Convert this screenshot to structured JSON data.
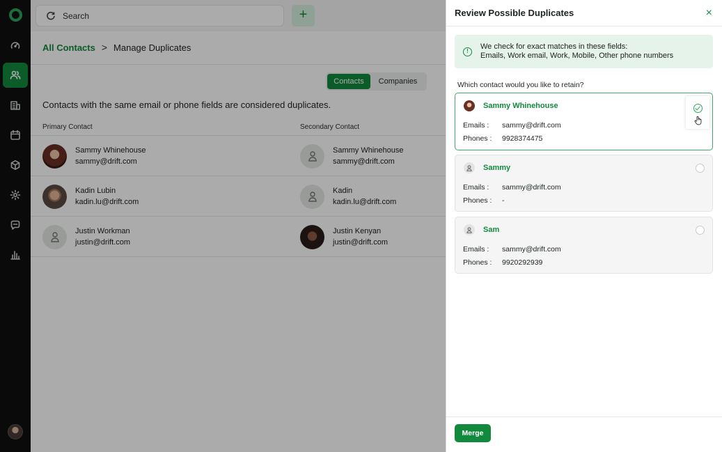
{
  "app": {
    "search_placeholder": "Search",
    "add_label": "+"
  },
  "sidebar": {
    "items": [
      {
        "name": "dashboard",
        "icon": "speedometer-icon",
        "active": false
      },
      {
        "name": "contacts",
        "icon": "users-icon",
        "active": true
      },
      {
        "name": "companies",
        "icon": "building-icon",
        "active": false
      },
      {
        "name": "calendar",
        "icon": "calendar-icon",
        "active": false
      },
      {
        "name": "products",
        "icon": "box-icon",
        "active": false
      },
      {
        "name": "settings",
        "icon": "gear-icon",
        "active": false
      },
      {
        "name": "chat",
        "icon": "chat-icon",
        "active": false
      },
      {
        "name": "reports",
        "icon": "bar-chart-icon",
        "active": false
      }
    ]
  },
  "breadcrumb": {
    "parent": "All Contacts",
    "separator": ">",
    "current": "Manage Duplicates"
  },
  "toggle": {
    "contacts": "Contacts",
    "companies": "Companies"
  },
  "main": {
    "description": "Contacts with the same email or phone fields are considered duplicates.",
    "col_primary": "Primary Contact",
    "col_secondary": "Secondary Contact",
    "rows": [
      {
        "primary": {
          "name": "Sammy Whinehouse",
          "email": "sammy@drift.com",
          "avatar": "photo-f"
        },
        "secondary": {
          "name": "Sammy Whinehouse",
          "email": "sammy@drift.com",
          "avatar": "ph"
        }
      },
      {
        "primary": {
          "name": "Kadin Lubin",
          "email": "kadin.lu@drift.com",
          "avatar": "photo-m"
        },
        "secondary": {
          "name": "Kadin",
          "email": "kadin.lu@drift.com",
          "avatar": "ph"
        }
      },
      {
        "primary": {
          "name": "Justin Workman",
          "email": "justin@drift.com",
          "avatar": "ph"
        },
        "secondary": {
          "name": "Justin Kenyan",
          "email": "justin@drift.com",
          "avatar": "photo-d"
        }
      }
    ]
  },
  "drawer": {
    "title": "Review Possible Duplicates",
    "close": "×",
    "info_line1": "We check for exact matches in these fields:",
    "info_line2": "Emails, Work email, Work, Mobile, Other phone numbers",
    "question": "Which contact would you like to retain?",
    "emails_label": "Emails :",
    "phones_label": "Phones :",
    "cards": [
      {
        "name": "Sammy Whinehouse",
        "email": "sammy@drift.com",
        "phone": "9928374475",
        "selected": true
      },
      {
        "name": "Sammy",
        "email": "sammy@drift.com",
        "phone": "-",
        "selected": false
      },
      {
        "name": "Sam",
        "email": "sammy@drift.com",
        "phone": "9920292939",
        "selected": false
      }
    ],
    "merge_label": "Merge"
  },
  "colors": {
    "accent": "#128a3e",
    "sidebar_bg": "#101010",
    "info_bg": "#e6f3ea"
  }
}
